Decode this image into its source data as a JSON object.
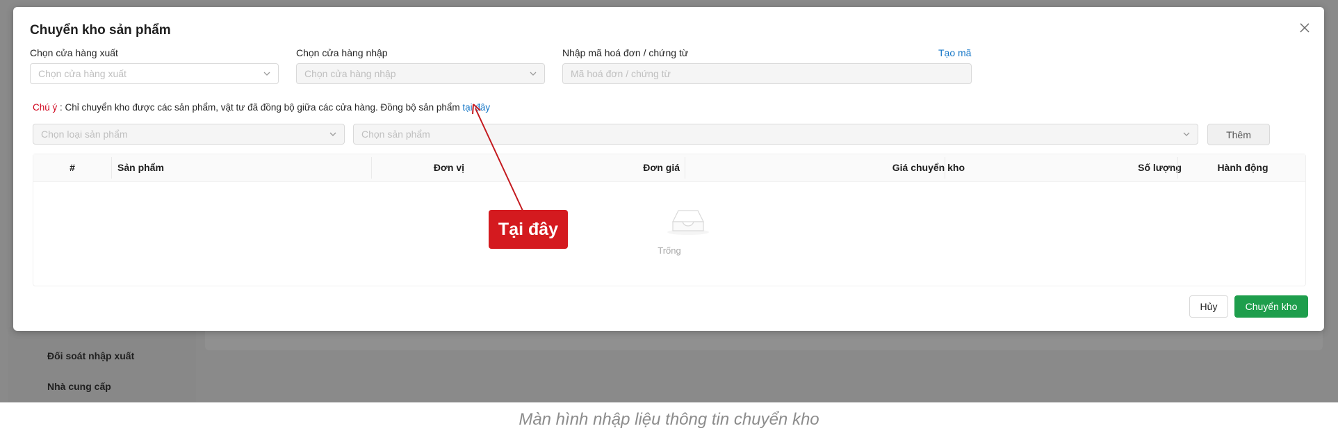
{
  "background": {
    "sidebar_items": [
      "Đối soát nhập xuất",
      "Nhà cung cấp"
    ]
  },
  "modal": {
    "title": "Chuyển kho sản phẩm",
    "export_store": {
      "label": "Chọn cửa hàng xuất",
      "placeholder": "Chọn cửa hàng xuất"
    },
    "import_store": {
      "label": "Chọn cửa hàng nhập",
      "placeholder": "Chọn cửa hàng nhập"
    },
    "invoice": {
      "label": "Nhập mã hoá đơn / chứng từ",
      "placeholder": "Mã hoá đơn / chứng từ",
      "generate_link": "Tạo mã"
    },
    "note": {
      "prefix": "Chú ý",
      "text": " : Chỉ chuyển kho được các sản phẩm, vật tư đã đồng bộ giữa các cửa hàng. Đồng bộ sản phẩm ",
      "link": "tại đây"
    },
    "product_type_select": {
      "placeholder": "Chọn loại sản phẩm"
    },
    "product_select": {
      "placeholder": "Chọn sản phẩm"
    },
    "add_button": "Thêm",
    "table": {
      "columns": [
        "#",
        "Sản phẩm",
        "Đơn vị",
        "Đơn giá",
        "Giá chuyển kho",
        "Số lượng",
        "Hành động"
      ],
      "empty_text": "Trống"
    },
    "cancel_button": "Hủy",
    "transfer_button": "Chuyển kho"
  },
  "annotation": {
    "label": "Tại đây",
    "color": "#d41a1f"
  },
  "caption": "Màn hình nhập liệu thông tin chuyển kho",
  "colors": {
    "primary_button": "#1e9e4c",
    "link": "#1677c7",
    "warning": "#d0021b"
  }
}
